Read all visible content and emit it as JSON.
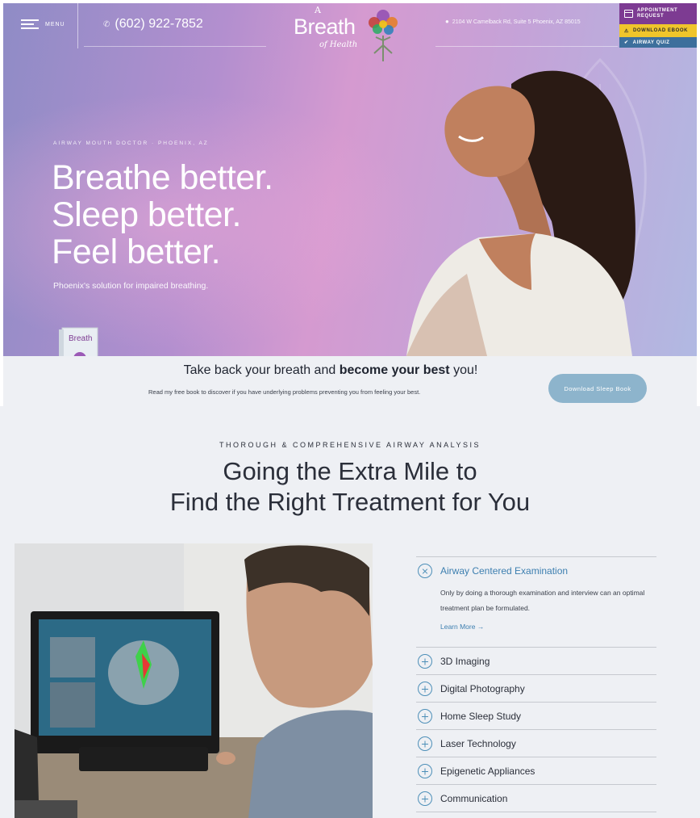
{
  "header": {
    "menu_label": "MENU",
    "phone": "(602) 922-7852",
    "logo": {
      "a": "A",
      "breath": "Breath",
      "health": "of Health"
    },
    "address": "2104 W Camelback Rd, Suite 5 Phoenix, AZ 85015",
    "buttons": {
      "appointment": "APPOINTMENT REQUEST",
      "ebook": "DOWNLOAD EBOOK",
      "quiz": "AIRWAY QUIZ"
    }
  },
  "hero": {
    "eyebrow": "AIRWAY MOUTH DOCTOR · PHOENIX, AZ",
    "headline": [
      "Breathe better.",
      "Sleep better.",
      "Feel better."
    ],
    "subtitle": "Phoenix's solution for impaired breathing."
  },
  "banner": {
    "title_start": "Take back your breath and ",
    "title_bold": "become your best",
    "title_end": " you!",
    "text": "Read my free book to discover if you have underlying problems preventing you from feeling your best.",
    "button": "Download Sleep Book",
    "book_title": "Breath"
  },
  "analysis": {
    "eyebrow": "THOROUGH & COMPREHENSIVE AIRWAY ANALYSIS",
    "title": [
      "Going the Extra Mile to",
      "Find the Right Treatment for You"
    ],
    "items": [
      {
        "label": "Airway Centered Examination",
        "open": true,
        "description": "Only by doing a thorough examination and interview can an optimal treatment plan be formulated.",
        "link": "Learn More →"
      },
      {
        "label": "3D Imaging"
      },
      {
        "label": "Digital Photography"
      },
      {
        "label": "Home Sleep Study"
      },
      {
        "label": "Laser Technology"
      },
      {
        "label": "Epigenetic Appliances"
      },
      {
        "label": "Communication"
      }
    ]
  },
  "colors": {
    "accent": "#3d7fb0",
    "appointment_bg": "#7d3b92",
    "ebook_bg": "#f0c52b",
    "quiz_bg": "#3d6f9c",
    "button_bg": "#8db4cc"
  }
}
